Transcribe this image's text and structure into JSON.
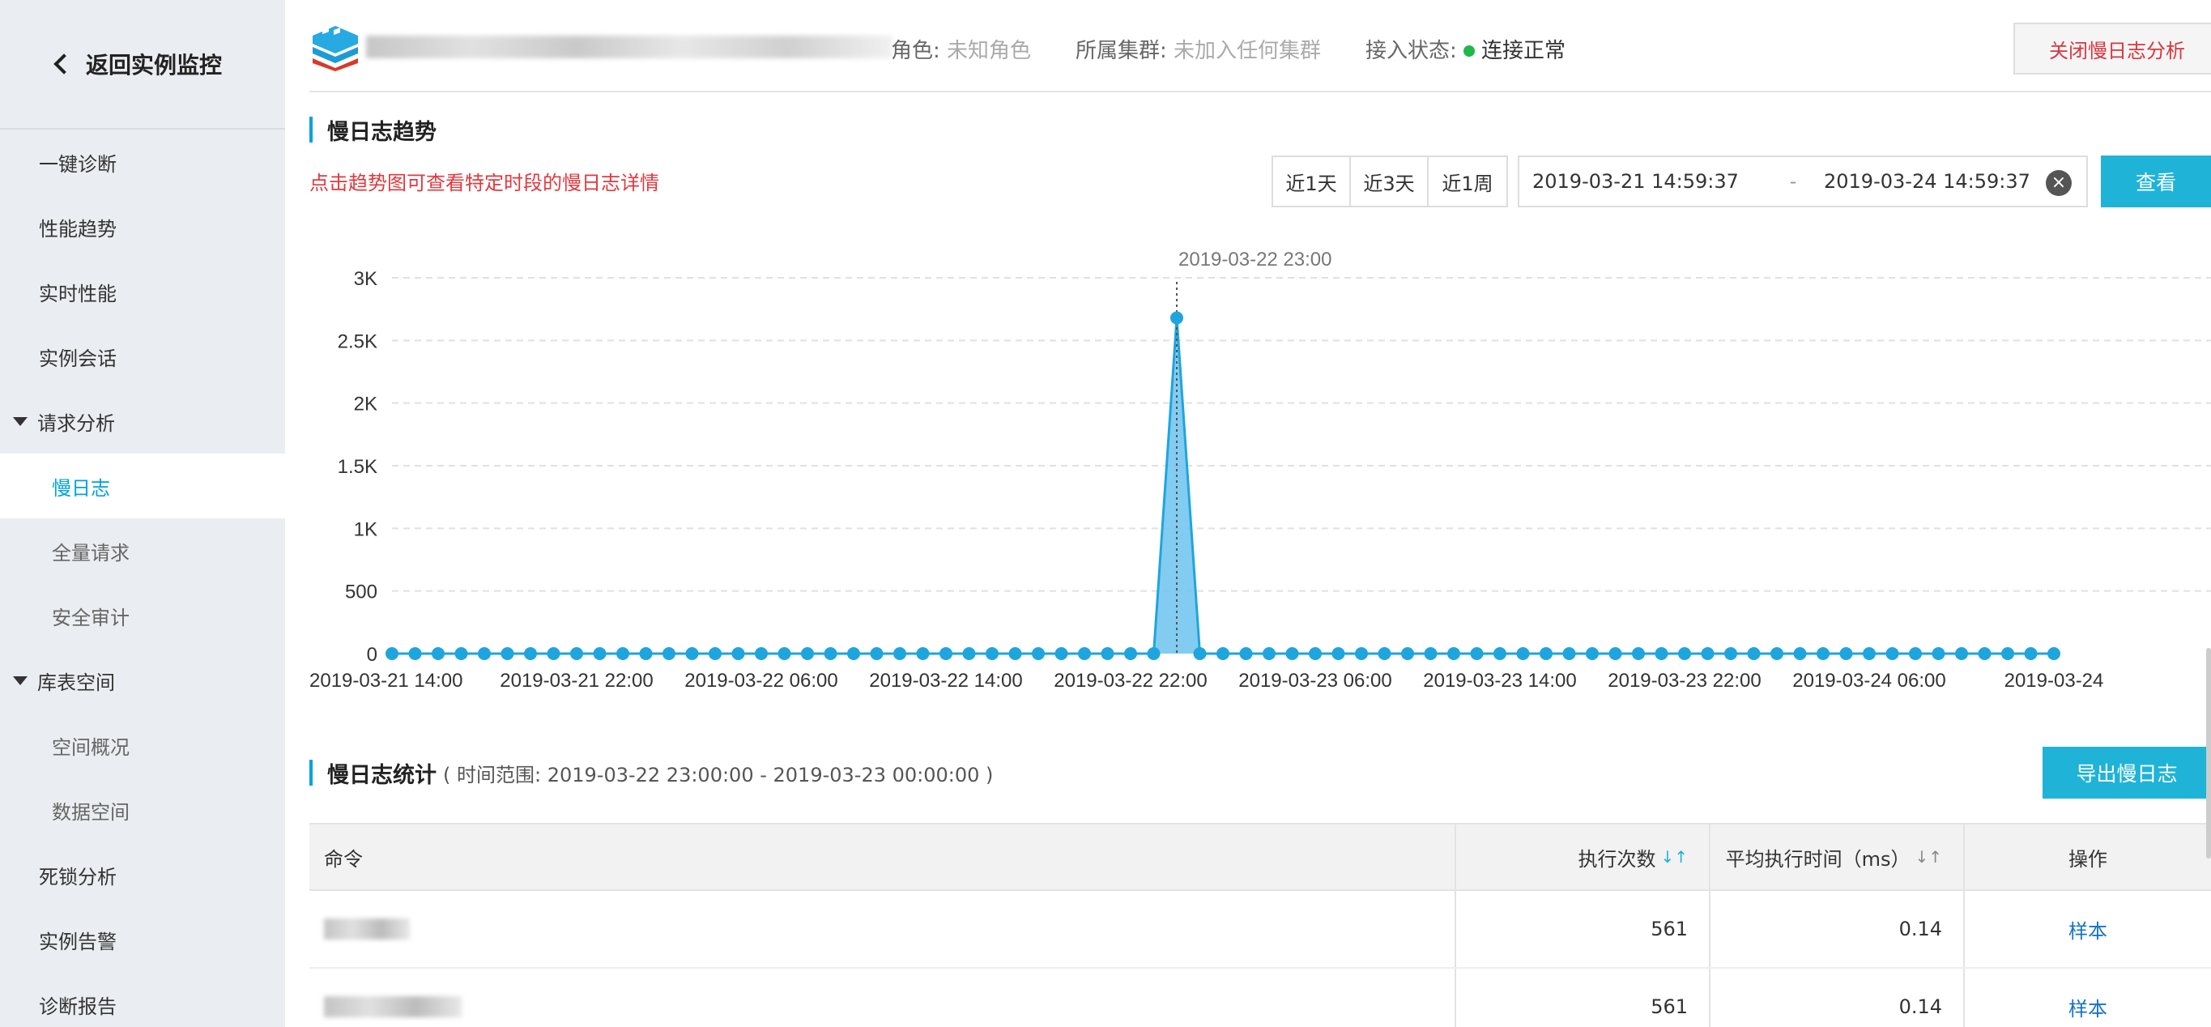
{
  "sidebar": {
    "back_label": "返回实例监控",
    "items": [
      {
        "label": "一键诊断"
      },
      {
        "label": "性能趋势"
      },
      {
        "label": "实时性能"
      },
      {
        "label": "实例会话"
      },
      {
        "label": "请求分析"
      },
      {
        "label": "慢日志"
      },
      {
        "label": "全量请求"
      },
      {
        "label": "安全审计"
      },
      {
        "label": "库表空间"
      },
      {
        "label": "空间概况"
      },
      {
        "label": "数据空间"
      },
      {
        "label": "死锁分析"
      },
      {
        "label": "实例告警"
      },
      {
        "label": "诊断报告"
      }
    ]
  },
  "header": {
    "role_label": "角色:",
    "role_value": "未知角色",
    "cluster_label": "所属集群:",
    "cluster_value": "未加入任何集群",
    "status_label": "接入状态:",
    "status_value": "连接正常",
    "close_button": "关闭慢日志分析"
  },
  "trend": {
    "title": "慢日志趋势",
    "hint": "点击趋势图可查看特定时段的慢日志详情",
    "range_buttons": [
      "近1天",
      "近3天",
      "近1周"
    ],
    "date_start": "2019-03-21 14:59:37",
    "date_separator": "-",
    "date_end": "2019-03-24 14:59:37",
    "query_button": "查看"
  },
  "chart_data": {
    "type": "area",
    "x_start": "2019-03-21 14:00",
    "x_step_hours": 1,
    "points": 73,
    "values": [
      0,
      0,
      0,
      0,
      0,
      0,
      0,
      0,
      0,
      0,
      0,
      0,
      0,
      0,
      0,
      0,
      0,
      0,
      0,
      0,
      0,
      0,
      0,
      0,
      0,
      0,
      0,
      0,
      0,
      0,
      0,
      0,
      0,
      0,
      2680,
      0,
      0,
      0,
      0,
      0,
      0,
      0,
      0,
      0,
      0,
      0,
      0,
      0,
      0,
      0,
      0,
      0,
      0,
      0,
      0,
      0,
      0,
      0,
      0,
      0,
      0,
      0,
      0,
      0,
      0,
      0,
      0,
      0,
      0,
      0,
      0,
      0,
      0
    ],
    "xticks": [
      "2019-03-21 14:00",
      "2019-03-21 22:00",
      "2019-03-22 06:00",
      "2019-03-22 14:00",
      "2019-03-22 22:00",
      "2019-03-23 06:00",
      "2019-03-23 14:00",
      "2019-03-23 22:00",
      "2019-03-24 06:00",
      "2019-03-24"
    ],
    "yticks": [
      "0",
      "500",
      "1K",
      "1.5K",
      "2K",
      "2.5K",
      "3K"
    ],
    "ylim": [
      0,
      3000
    ],
    "grid": true,
    "tooltip_label": "2019-03-22 23:00",
    "colors": {
      "line": "#1fa5dd",
      "fill": "#6cc3ee"
    }
  },
  "stats": {
    "title": "慢日志统计",
    "range_text": "( 时间范围: 2019-03-22 23:00:00 - 2019-03-23 00:00:00 )",
    "export_button": "导出慢日志",
    "columns": [
      "命令",
      "执行次数",
      "平均执行时间（ms）",
      "操作"
    ],
    "rows": [
      {
        "count": "561",
        "avg": "0.14",
        "action": "样本"
      },
      {
        "count": "561",
        "avg": "0.14",
        "action": "样本"
      }
    ]
  },
  "colors": {
    "accent": "#1fb3d8",
    "danger": "#e0393e",
    "ok": "#1fb84a"
  }
}
